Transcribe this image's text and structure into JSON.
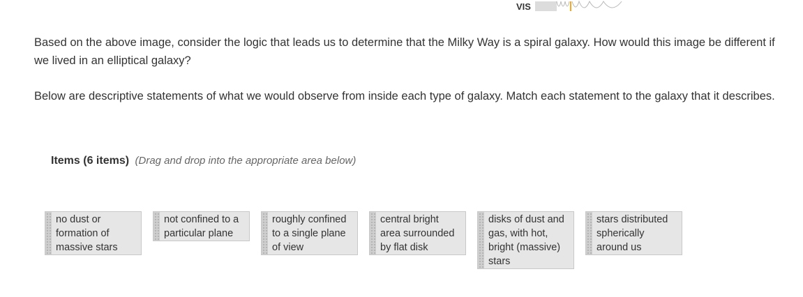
{
  "spectrum": {
    "label": "VIS",
    "icon": "wave-spectrum-icon"
  },
  "question": {
    "paragraph1": "Based on the above image, consider the logic that leads us to determine that the Milky Way is a spiral galaxy. How would this image be different if we lived in an elliptical galaxy?",
    "paragraph2": "Below are descriptive statements of what we would observe from inside each type of galaxy. Match each statement to the galaxy that it describes."
  },
  "items": {
    "header": "Items (6 items)",
    "hint": "(Drag and drop into the appropriate area below)",
    "tiles": [
      {
        "label": "no dust or formation of massive stars"
      },
      {
        "label": "not confined to a particular plane"
      },
      {
        "label": "roughly confined to a single plane of view"
      },
      {
        "label": "central bright area surrounded by flat disk"
      },
      {
        "label": "disks of dust and gas, with hot, bright (massive) stars"
      },
      {
        "label": "stars distributed spherically around us"
      }
    ]
  },
  "colors": {
    "tile_background": "#e6e6e6",
    "tile_border": "#c8c8c8",
    "text": "#333333",
    "hint": "#666666",
    "spectrum_orange": "#f5a623"
  }
}
